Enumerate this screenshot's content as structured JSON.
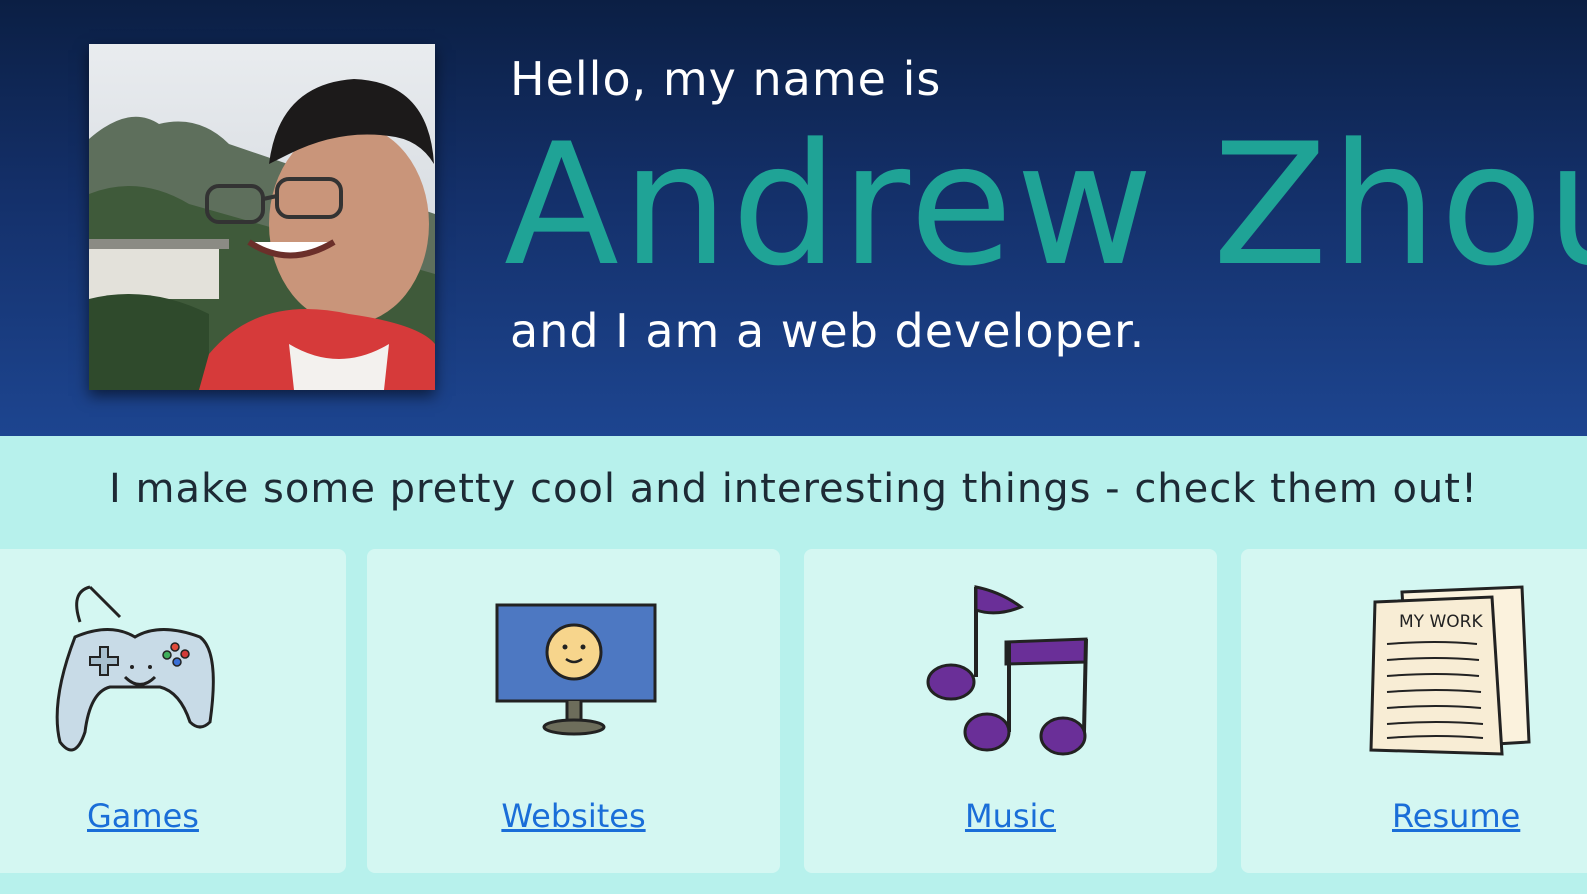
{
  "hero": {
    "greeting": "Hello, my name is",
    "name": "Andrew Zhou",
    "role": "and I am a web developer."
  },
  "projects": {
    "tagline": "I make some pretty cool and interesting things - check them out!",
    "cards": [
      {
        "label": "Games",
        "icon": "game-controller-icon"
      },
      {
        "label": "Websites",
        "icon": "monitor-smiley-icon"
      },
      {
        "label": "Music",
        "icon": "music-notes-icon"
      },
      {
        "label": "Resume",
        "icon": "resume-document-icon"
      }
    ],
    "resume_icon_text": "MY WORK"
  },
  "colors": {
    "name_accent": "#1fa396",
    "link": "#1a6ed8",
    "hero_top": "#0b1f44",
    "hero_bottom": "#1d4590",
    "page_bg": "#b7f1ec",
    "card_bg": "#d4f7f2"
  }
}
